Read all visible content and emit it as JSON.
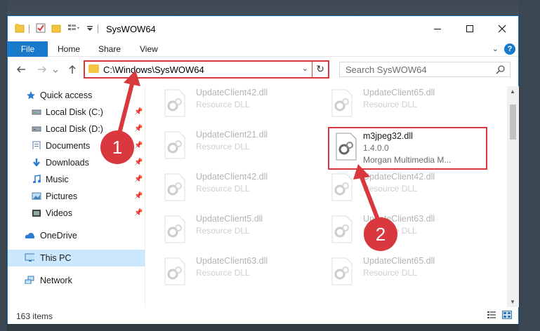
{
  "window": {
    "title": "SysWOW64"
  },
  "ribbon": {
    "file_label": "File",
    "tabs": [
      "Home",
      "Share",
      "View"
    ],
    "help_label": "?"
  },
  "address": {
    "path": "C:\\Windows\\SysWOW64"
  },
  "search": {
    "placeholder": "Search SysWOW64"
  },
  "sidebar": {
    "items": [
      {
        "label": "Quick access",
        "icon": "star-icon"
      },
      {
        "label": "Local Disk (C:)",
        "icon": "drive-icon",
        "pinned": true
      },
      {
        "label": "Local Disk (D:)",
        "icon": "drive-icon",
        "pinned": true
      },
      {
        "label": "Documents",
        "icon": "documents-icon",
        "pinned": true
      },
      {
        "label": "Downloads",
        "icon": "downloads-icon",
        "pinned": true
      },
      {
        "label": "Music",
        "icon": "music-icon",
        "pinned": true
      },
      {
        "label": "Pictures",
        "icon": "pictures-icon",
        "pinned": true
      },
      {
        "label": "Videos",
        "icon": "videos-icon",
        "pinned": true
      },
      {
        "label": "OneDrive",
        "icon": "cloud-icon"
      },
      {
        "label": "This PC",
        "icon": "computer-icon",
        "selected": true
      },
      {
        "label": "Network",
        "icon": "network-icon"
      }
    ]
  },
  "files": [
    {
      "name": "UpdateClient42.dll",
      "desc": "Resource DLL"
    },
    {
      "name": "UpdateClient65.dll",
      "desc": "Resource DLL"
    },
    {
      "name": "UpdateClient21.dll",
      "desc": "Resource DLL"
    },
    {
      "name": "m3jpeg32.dll",
      "version": "1.4.0.0",
      "desc": "Morgan Multimedia M...",
      "highlighted": true
    },
    {
      "name": "UpdateClient42.dll",
      "desc": "Resource DLL"
    },
    {
      "name": "UpdateClient42.dll",
      "desc": "Resource DLL"
    },
    {
      "name": "UpdateClient5.dll",
      "desc": "Resource DLL"
    },
    {
      "name": "UpdateClient63.dll",
      "desc": "Resource DLL"
    },
    {
      "name": "UpdateClient63.dll",
      "desc": "Resource DLL"
    },
    {
      "name": "UpdateClient65.dll",
      "desc": "Resource DLL"
    }
  ],
  "status": {
    "item_count": "163 items"
  },
  "annotations": {
    "badge1": "1",
    "badge2": "2",
    "color": "#d9393e"
  }
}
